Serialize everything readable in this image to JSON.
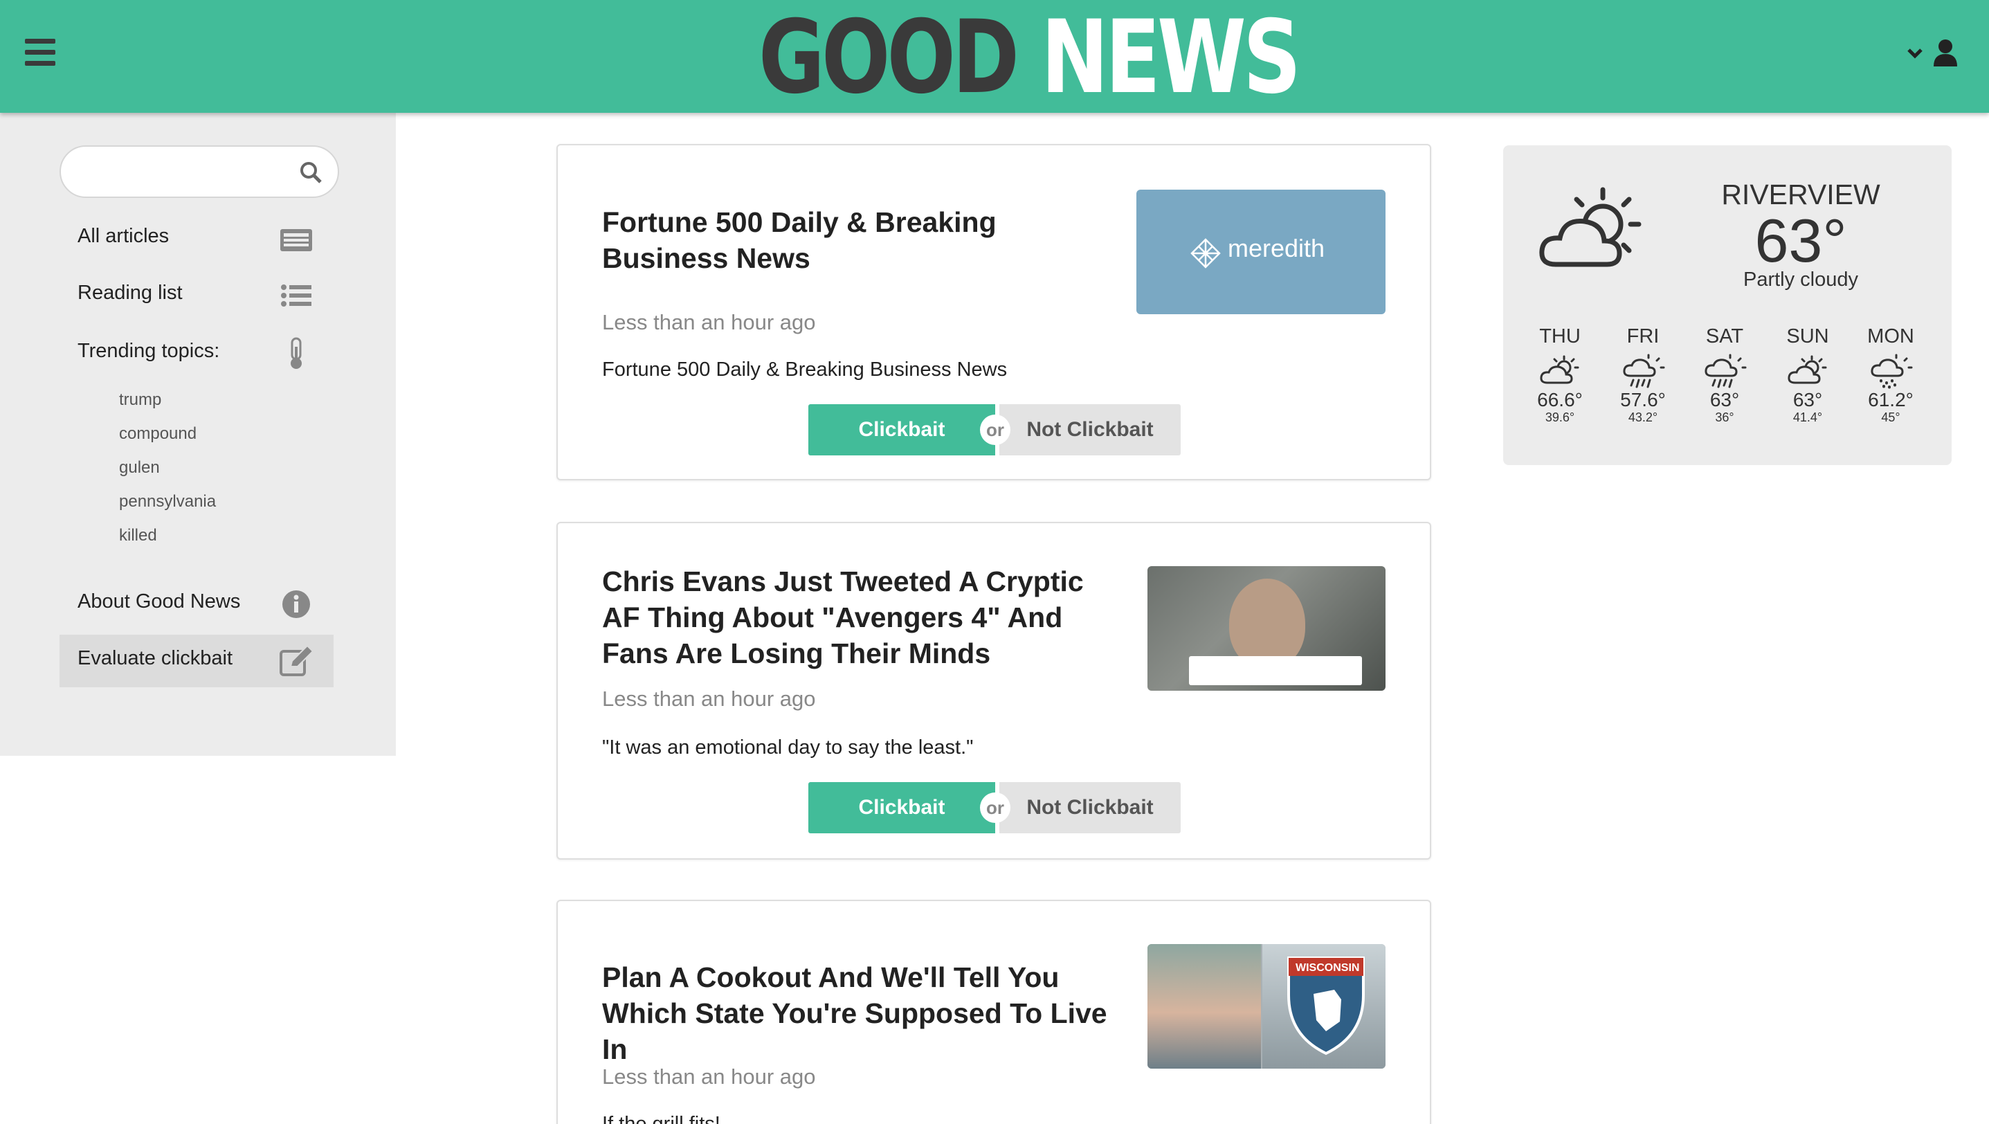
{
  "header": {
    "logo_good": "GOOD",
    "logo_news": "NEWS"
  },
  "sidebar": {
    "search": {
      "placeholder": "",
      "value": ""
    },
    "items": [
      {
        "label": "All articles",
        "icon": "newspaper-icon"
      },
      {
        "label": "Reading list",
        "icon": "list-icon"
      },
      {
        "label": "Trending topics:",
        "icon": "thermometer-icon"
      },
      {
        "label": "About Good News",
        "icon": "info-icon"
      },
      {
        "label": "Evaluate clickbait",
        "icon": "edit-icon",
        "active": true
      }
    ],
    "topics": [
      "trump",
      "compound",
      "gulen",
      "pennsylvania",
      "killed"
    ]
  },
  "articles": [
    {
      "title": "Fortune 500 Daily & Breaking Business News",
      "time": "Less than an hour ago",
      "description": "Fortune 500 Daily & Breaking Business News",
      "image_text": "meredith"
    },
    {
      "title": "Chris Evans Just Tweeted A Cryptic AF Thing About \"Avengers 4\" And Fans Are Losing Their Minds",
      "time": "Less than an hour ago",
      "description": "\"It was an emotional day to say the least.\""
    },
    {
      "title": "Plan A Cookout And We'll Tell You Which State You're Supposed To Live In",
      "time": "Less than an hour ago",
      "description": "If the grill fits!",
      "image_sign_text": "WISCONSIN"
    }
  ],
  "vote": {
    "clickbait": "Clickbait",
    "or": "or",
    "not_clickbait": "Not Clickbait"
  },
  "weather": {
    "city": "RIVERVIEW",
    "temp": "63°",
    "condition": "Partly cloudy",
    "forecast": [
      {
        "day": "THU",
        "high": "66.6°",
        "low": "39.6°",
        "icon": "partly-cloudy-icon"
      },
      {
        "day": "FRI",
        "high": "57.6°",
        "low": "43.2°",
        "icon": "rain-icon"
      },
      {
        "day": "SAT",
        "high": "63°",
        "low": "36°",
        "icon": "rain-icon"
      },
      {
        "day": "SUN",
        "high": "63°",
        "low": "41.4°",
        "icon": "partly-cloudy-icon"
      },
      {
        "day": "MON",
        "high": "61.2°",
        "low": "45°",
        "icon": "snow-icon"
      }
    ]
  },
  "colors": {
    "brand": "#42bc99",
    "logo_dark": "#3a3a3a",
    "sidebar_bg": "#ececec"
  }
}
